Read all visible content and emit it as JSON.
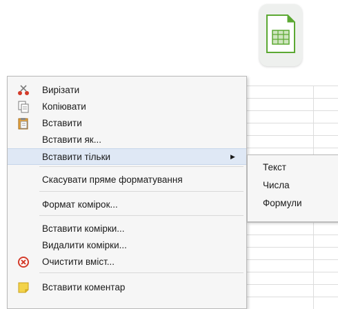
{
  "app": {
    "icon": "libreoffice-calc-icon"
  },
  "context_menu": {
    "items": [
      {
        "label": "Вирізати",
        "icon": "scissors-icon"
      },
      {
        "label": "Копіювати",
        "icon": "copy-icon"
      },
      {
        "label": "Вставити",
        "icon": "paste-icon"
      },
      {
        "label": "Вставити як..."
      },
      {
        "label": "Вставити тільки",
        "has_submenu": true,
        "highlighted": true
      },
      {
        "label": "Скасувати пряме форматування"
      },
      {
        "label": "Формат комірок..."
      },
      {
        "label": "Вставити комірки..."
      },
      {
        "label": "Видалити комірки..."
      },
      {
        "label": "Очистити вміст...",
        "icon": "clear-contents-icon"
      },
      {
        "label": "Вставити коментар",
        "icon": "comment-icon"
      }
    ]
  },
  "submenu": {
    "items": [
      {
        "label": "Текст"
      },
      {
        "label": "Числа"
      },
      {
        "label": "Формули"
      }
    ]
  },
  "colors": {
    "highlight": "#dfe8f5",
    "menu_bg": "#f6f6f6",
    "logo_green": "#5ba832"
  }
}
